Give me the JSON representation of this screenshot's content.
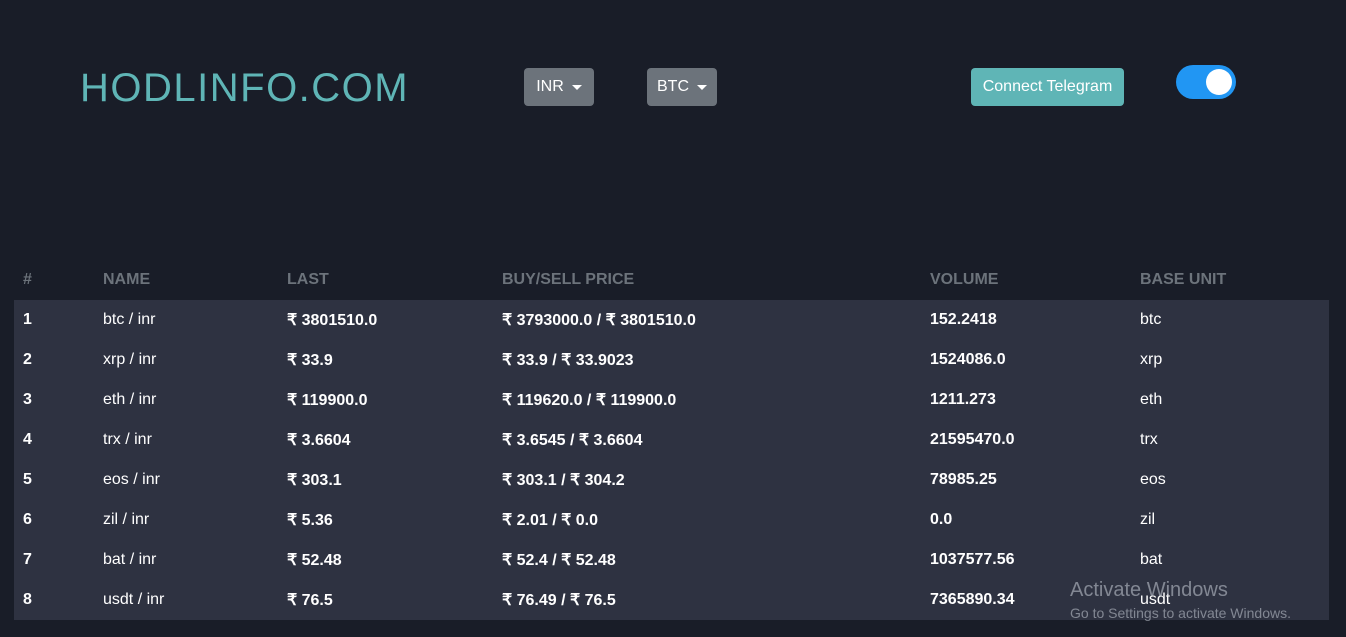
{
  "header": {
    "logo": "HODLINFO.COM",
    "currency_dropdown": "INR",
    "coin_dropdown": "BTC",
    "telegram_button": "Connect Telegram",
    "theme_toggle_on": true
  },
  "table": {
    "columns": [
      "#",
      "NAME",
      "LAST",
      "BUY/SELL PRICE",
      "VOLUME",
      "BASE UNIT"
    ],
    "rows": [
      {
        "num": "1",
        "name": "btc / inr",
        "last": "₹ 3801510.0",
        "buy_sell": "₹ 3793000.0 / ₹ 3801510.0",
        "volume": "152.2418",
        "base": "btc"
      },
      {
        "num": "2",
        "name": "xrp / inr",
        "last": "₹ 33.9",
        "buy_sell": "₹ 33.9 / ₹ 33.9023",
        "volume": "1524086.0",
        "base": "xrp"
      },
      {
        "num": "3",
        "name": "eth / inr",
        "last": "₹ 119900.0",
        "buy_sell": "₹ 119620.0 / ₹ 119900.0",
        "volume": "1211.273",
        "base": "eth"
      },
      {
        "num": "4",
        "name": "trx / inr",
        "last": "₹ 3.6604",
        "buy_sell": "₹ 3.6545 / ₹ 3.6604",
        "volume": "21595470.0",
        "base": "trx"
      },
      {
        "num": "5",
        "name": "eos / inr",
        "last": "₹ 303.1",
        "buy_sell": "₹ 303.1 / ₹ 304.2",
        "volume": "78985.25",
        "base": "eos"
      },
      {
        "num": "6",
        "name": "zil / inr",
        "last": "₹ 5.36",
        "buy_sell": "₹ 2.01 / ₹ 0.0",
        "volume": "0.0",
        "base": "zil"
      },
      {
        "num": "7",
        "name": "bat / inr",
        "last": "₹ 52.48",
        "buy_sell": "₹ 52.4 / ₹ 52.48",
        "volume": "1037577.56",
        "base": "bat"
      },
      {
        "num": "8",
        "name": "usdt / inr",
        "last": "₹ 76.5",
        "buy_sell": "₹ 76.49 / ₹ 76.5",
        "volume": "7365890.34",
        "base": "usdt"
      }
    ]
  },
  "watermark": {
    "title": "Activate Windows",
    "subtitle": "Go to Settings to activate Windows."
  },
  "colors": {
    "background": "#191d28",
    "row_background": "#2e3241",
    "accent": "#5fb5b6",
    "toggle": "#2196f3",
    "dropdown": "#6c737b"
  }
}
